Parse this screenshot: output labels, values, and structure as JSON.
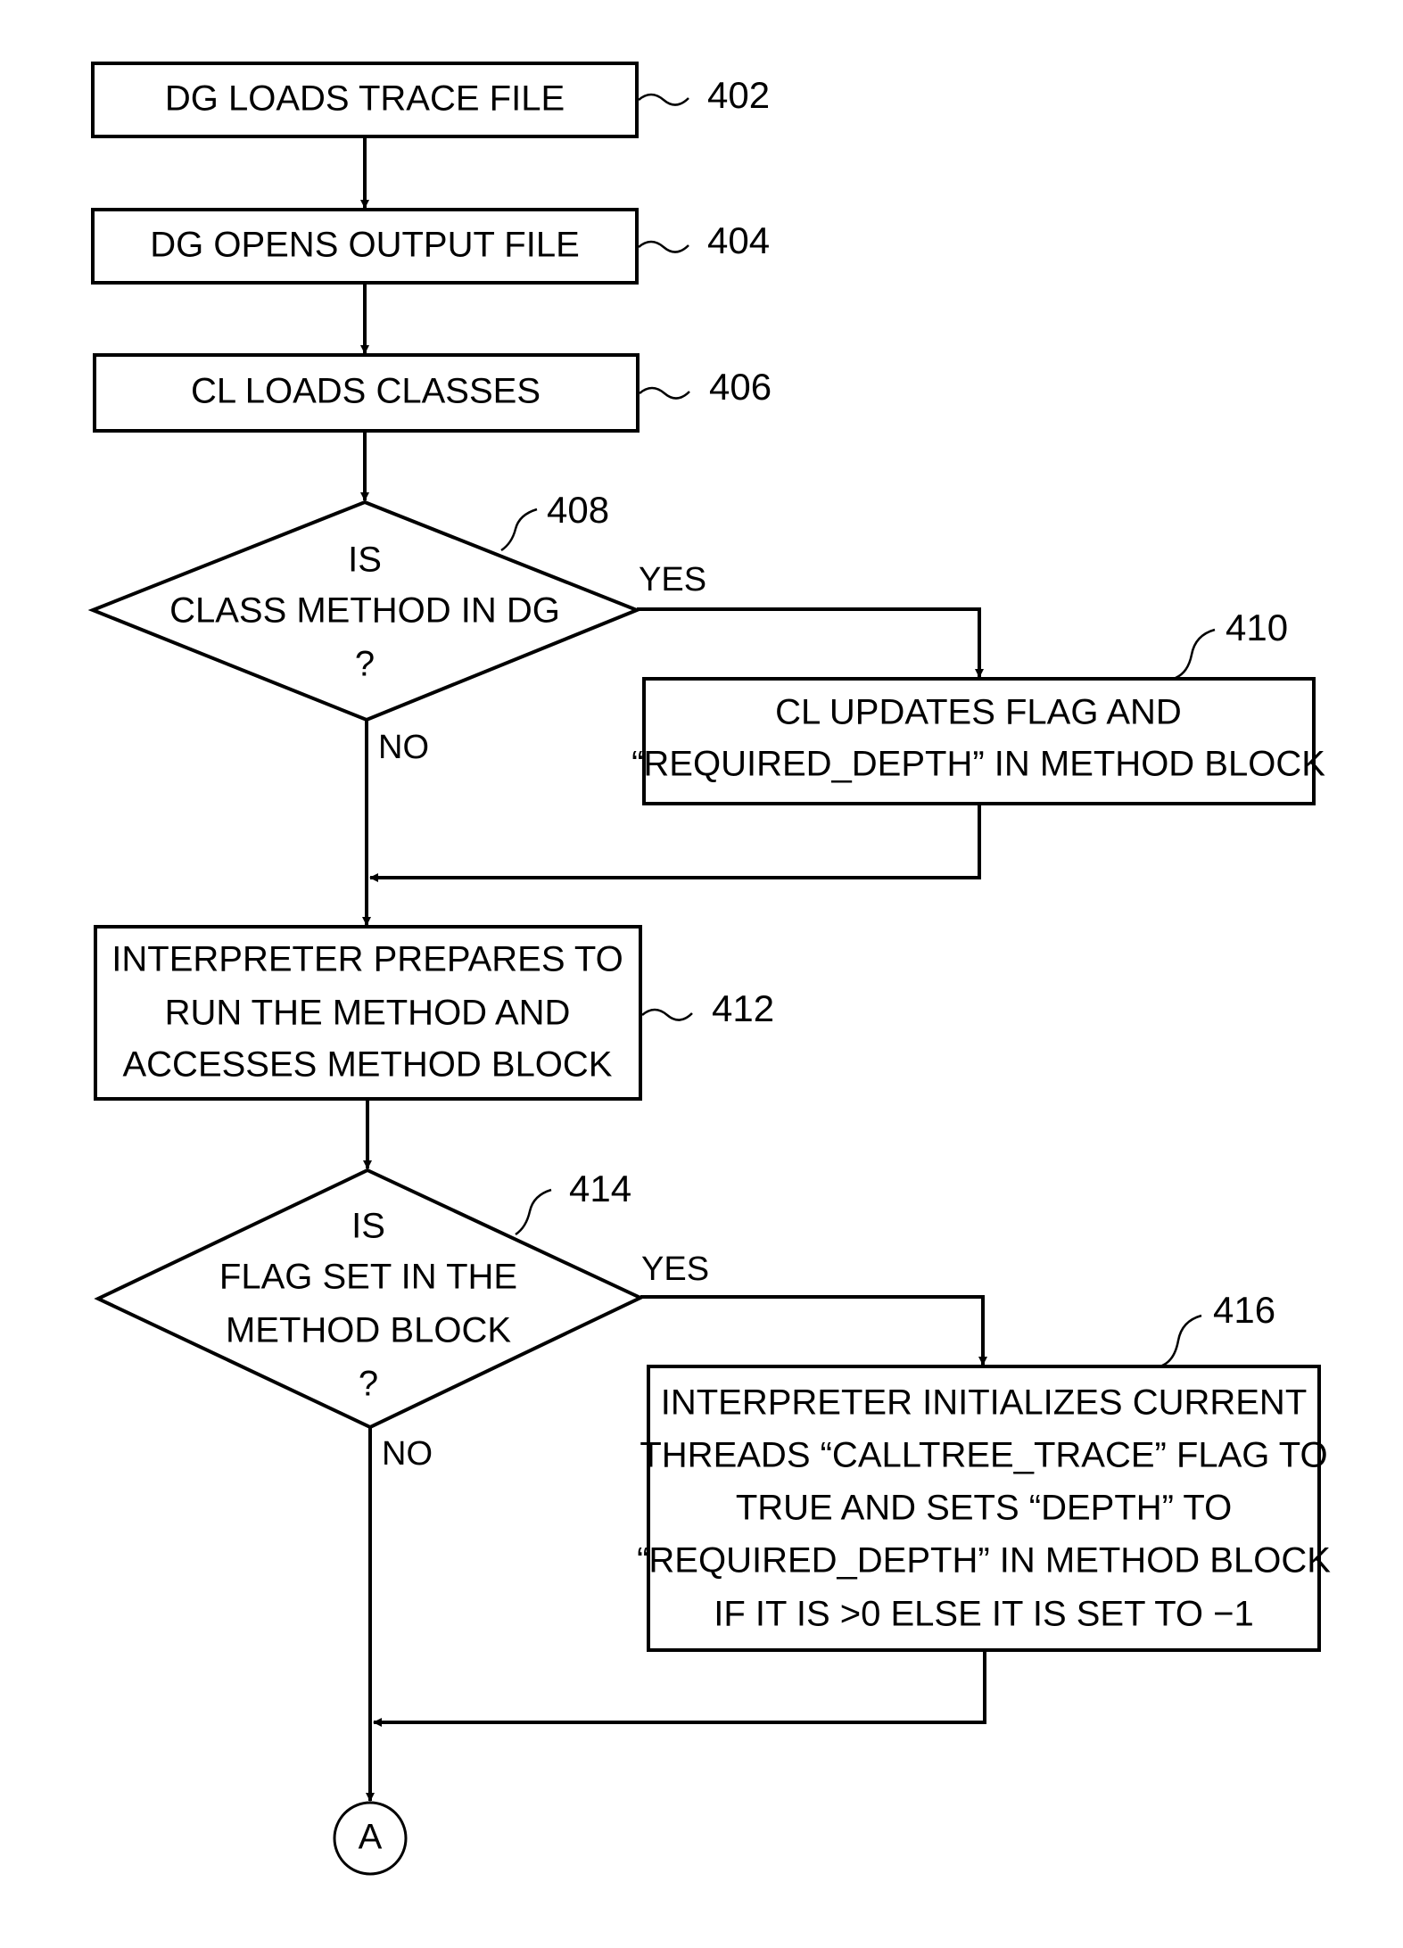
{
  "figure": {
    "nodes": [
      {
        "id": "402",
        "type": "process",
        "ref": "402",
        "lines": [
          "DG LOADS TRACE FILE"
        ]
      },
      {
        "id": "404",
        "type": "process",
        "ref": "404",
        "lines": [
          "DG OPENS OUTPUT FILE"
        ]
      },
      {
        "id": "406",
        "type": "process",
        "ref": "406",
        "lines": [
          "CL LOADS CLASSES"
        ]
      },
      {
        "id": "408",
        "type": "decision",
        "ref": "408",
        "lines": [
          "IS",
          "CLASS METHOD IN DG",
          "?"
        ]
      },
      {
        "id": "410",
        "type": "process",
        "ref": "410",
        "lines": [
          "CL UPDATES FLAG AND",
          "“REQUIRED_DEPTH” IN METHOD BLOCK"
        ]
      },
      {
        "id": "412",
        "type": "process",
        "ref": "412",
        "lines": [
          "INTERPRETER PREPARES TO",
          "RUN THE METHOD AND",
          "ACCESSES METHOD BLOCK"
        ]
      },
      {
        "id": "414",
        "type": "decision",
        "ref": "414",
        "lines": [
          "IS",
          "FLAG SET IN THE",
          "METHOD BLOCK",
          "?"
        ]
      },
      {
        "id": "416",
        "type": "process",
        "ref": "416",
        "lines": [
          "INTERPRETER INITIALIZES CURRENT",
          "THREADS “CALLTREE_TRACE” FLAG TO",
          "TRUE AND SETS “DEPTH” TO",
          "“REQUIRED_DEPTH” IN METHOD BLOCK",
          "IF IT IS >0 ELSE IT IS SET TO −1"
        ]
      },
      {
        "id": "A",
        "type": "connector",
        "lines": [
          "A"
        ]
      }
    ],
    "edges": [
      {
        "from": "402",
        "to": "404"
      },
      {
        "from": "404",
        "to": "406"
      },
      {
        "from": "406",
        "to": "408"
      },
      {
        "from": "408",
        "to": "410",
        "label": "YES"
      },
      {
        "from": "408",
        "to": "412",
        "label": "NO"
      },
      {
        "from": "410",
        "to": "412"
      },
      {
        "from": "412",
        "to": "414"
      },
      {
        "from": "414",
        "to": "416",
        "label": "YES"
      },
      {
        "from": "414",
        "to": "A",
        "label": "NO"
      },
      {
        "from": "416",
        "to": "A"
      }
    ],
    "labels": {
      "yes": "YES",
      "no": "NO"
    }
  }
}
